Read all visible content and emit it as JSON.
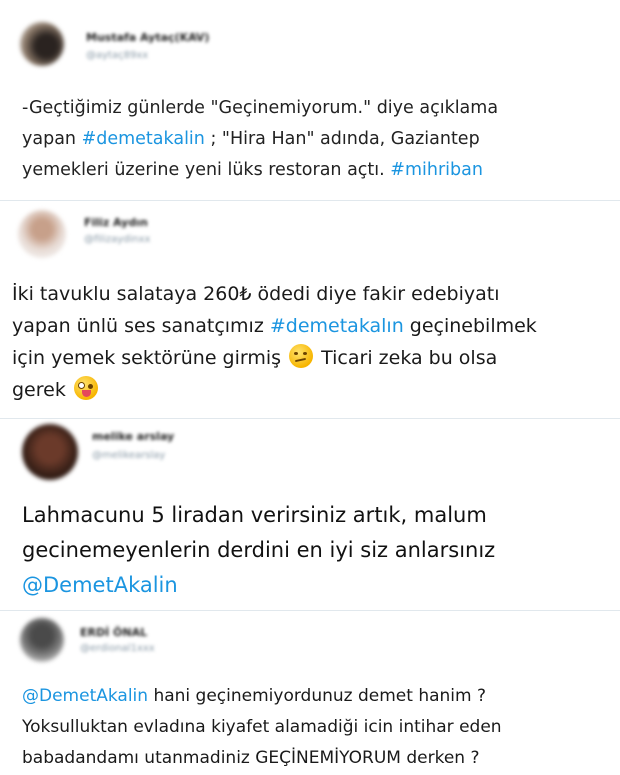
{
  "tweets": [
    {
      "author": "Mustafa Aytaç(KAV)",
      "handle": "@aytaç89xx",
      "lines": [
        [
          {
            "t": "-Geçtiğimiz günlerde \"Geçinemiyorum.\" diye açıklama"
          }
        ],
        [
          {
            "t": "yapan "
          },
          {
            "t": "#demetakalin",
            "tag": true
          },
          {
            "t": " ; \"Hira Han\" adında, Gaziantep"
          }
        ],
        [
          {
            "t": "yemekleri üzerine yeni lüks restoran açtı. "
          },
          {
            "t": "#mihriban",
            "tag": true
          }
        ]
      ]
    },
    {
      "author": "Filiz Aydın",
      "handle": "@filizaydinxx",
      "lines": [
        [
          {
            "t": "İki tavuklu salataya 260₺ ödedi diye fakir edebiyatı"
          }
        ],
        [
          {
            "t": "yapan ünlü ses sanatçımız "
          },
          {
            "t": "#demetakalın",
            "tag": true
          },
          {
            "t": " geçinebilmek"
          }
        ],
        [
          {
            "t": "için yemek sektörüne girmiş "
          },
          {
            "emoji": "thinking-face"
          },
          {
            "t": " Ticari zeka bu olsa"
          }
        ],
        [
          {
            "t": "gerek "
          },
          {
            "emoji": "zany-face"
          }
        ]
      ]
    },
    {
      "author": "melike arslay",
      "handle": "@melikearslay",
      "lines": [
        [
          {
            "t": "Lahmacunu 5 liradan verirsiniz artık, malum"
          }
        ],
        [
          {
            "t": "gecinemeyenlerin derdini en iyi siz anlarsınız"
          }
        ],
        [
          {
            "t": "@DemetAkalin",
            "tag": true
          }
        ]
      ]
    },
    {
      "author": "ERDİ ÖNAL",
      "handle": "@erdional1xxx",
      "lines": [
        [
          {
            "t": "@DemetAkalin",
            "tag": true
          },
          {
            "t": " hani geçinemiyordunuz demet hanim ?"
          }
        ],
        [
          {
            "t": "Yoksulluktan evladına kiyafet alamadiği icin intihar eden"
          }
        ],
        [
          {
            "t": "babadandamı utanmadiniz GEÇİNEMİYORUM derken ?"
          }
        ]
      ]
    }
  ],
  "colors": {
    "hashtag": "#1b95e0",
    "separator": "#e1e8ed",
    "handle": "#8899a6"
  }
}
